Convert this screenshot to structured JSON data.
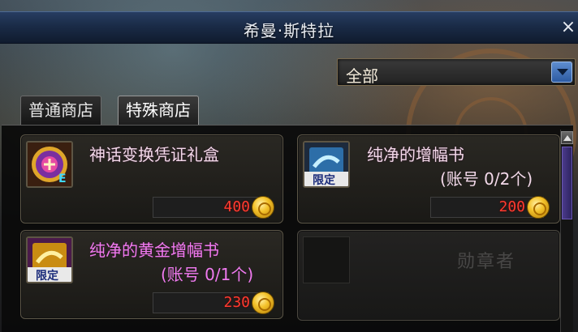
{
  "window": {
    "title": "希曼·斯特拉",
    "close_glyph": "×"
  },
  "filter": {
    "selected": "全部",
    "icon": "chevron-down-icon"
  },
  "tabs": [
    {
      "label": "普通商店",
      "active": false
    },
    {
      "label": "特殊商店",
      "active": true
    }
  ],
  "items": [
    {
      "name": "神话变换凭证礼盒",
      "subtitle": "",
      "price": "400",
      "icon": "myth-exchange-box-icon"
    },
    {
      "name": "纯净的增幅书",
      "subtitle": "(账号 0/2个)",
      "price": "200",
      "icon": "amplify-book-icon",
      "badge": "限定"
    },
    {
      "name": "纯净的黄金增幅书",
      "subtitle": "(账号 0/1个)",
      "price": "230",
      "icon": "golden-amplify-book-icon",
      "badge": "限定"
    }
  ],
  "currency_icon": "gold-coin-icon",
  "colors": {
    "price": "#ff3b30",
    "magenta_name": "#f07af0",
    "title_bar": "#1a2b47"
  },
  "misc": {
    "watermark_text": "勋章者"
  }
}
